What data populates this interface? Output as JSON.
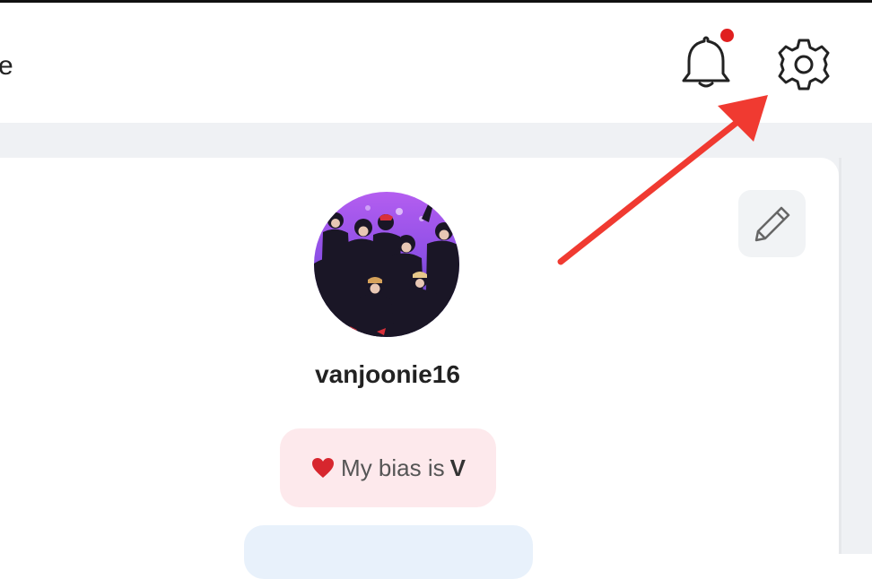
{
  "header": {
    "title_fragment": "e",
    "notification_icon": "bell-icon",
    "notification_badge_color": "#e01f1f",
    "settings_icon": "gear-icon"
  },
  "profile": {
    "username": "vanjoonie16",
    "avatar_alt": "profile-photo",
    "edit_icon": "pencil-icon",
    "bias": {
      "icon": "heart-icon",
      "prefix": "My bias is",
      "name": "V"
    }
  },
  "annotation": {
    "arrow_color": "#f03a31",
    "points_to": "settings-button"
  },
  "colors": {
    "page_background": "#eff1f4",
    "card_background": "#ffffff",
    "bias_pill": "#fde9ec",
    "second_pill": "#e8f1fb"
  }
}
